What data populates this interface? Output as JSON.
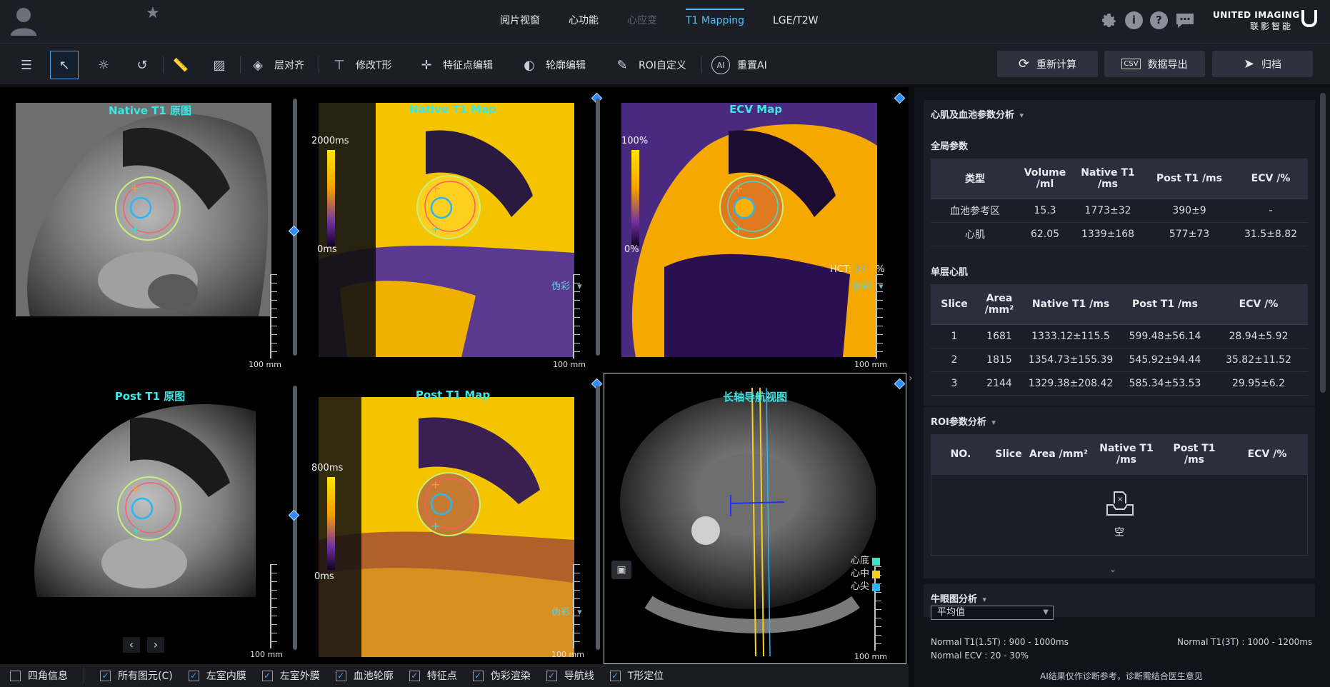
{
  "nav": {
    "tabs": [
      {
        "label": "阅片视窗"
      },
      {
        "label": "心功能"
      },
      {
        "label": "心应变"
      },
      {
        "label": "T1 Mapping"
      },
      {
        "label": "LGE/T2W"
      }
    ],
    "active_tab": "T1 Mapping",
    "disabled_tab": "心应变"
  },
  "brand": {
    "name_en": "UNITED IMAGING",
    "name_cn": "联影智能"
  },
  "toolbar": {
    "tools": [
      {
        "label": "层对齐"
      },
      {
        "label": "修改T形"
      },
      {
        "label": "特征点编辑"
      },
      {
        "label": "轮廓编辑"
      },
      {
        "label": "ROI自定义"
      },
      {
        "label": "重置AI"
      }
    ],
    "actions": {
      "recalc": "重新计算",
      "export": "数据导出",
      "archive": "归档"
    }
  },
  "viewer": {
    "cells": [
      {
        "title": "Native T1 原图",
        "ruler": "100 mm"
      },
      {
        "title": "Native T1 Map",
        "ruler": "100 mm",
        "cbar_max": "2000ms",
        "cbar_min": "0ms",
        "render": "伪彩"
      },
      {
        "title": "ECV Map",
        "ruler": "100 mm",
        "cbar_max": "100%",
        "cbar_min": "0%",
        "render": "伪彩",
        "hct_label": "HCT:",
        "hct_value": "37",
        "hct_unit": "%"
      },
      {
        "title": "Post T1 原图",
        "ruler": "100 mm"
      },
      {
        "title": "Post T1 Map",
        "ruler": "100 mm",
        "cbar_max": "800ms",
        "cbar_min": "0ms",
        "render": "伪彩"
      },
      {
        "title": "长轴导航视图",
        "ruler": "100 mm",
        "legend": [
          "心底",
          "心中",
          "心尖"
        ]
      }
    ],
    "legend_colors": [
      "#3de0c8",
      "#f5d020",
      "#29b6f6"
    ]
  },
  "bottombar": {
    "checks": [
      {
        "label": "四角信息",
        "checked": false
      },
      {
        "label": "所有图元(C)",
        "checked": true
      },
      {
        "label": "左室内膜",
        "checked": true
      },
      {
        "label": "左室外膜",
        "checked": true
      },
      {
        "label": "血池轮廓",
        "checked": true
      },
      {
        "label": "特征点",
        "checked": true
      },
      {
        "label": "伪彩渲染",
        "checked": true
      },
      {
        "label": "导航线",
        "checked": true
      },
      {
        "label": "T形定位",
        "checked": true
      }
    ]
  },
  "panel": {
    "section1": "心肌及血池参数分析",
    "global_title": "全局参数",
    "global_headers": [
      "类型",
      "Volume /ml",
      "Native T1 /ms",
      "Post T1 /ms",
      "ECV /%"
    ],
    "global_rows": [
      [
        "血池参考区",
        "15.3",
        "1773±32",
        "390±9",
        "-"
      ],
      [
        "心肌",
        "62.05",
        "1339±168",
        "577±73",
        "31.5±8.82"
      ]
    ],
    "slice_title": "单层心肌",
    "slice_headers": [
      "Slice",
      "Area /mm²",
      "Native T1 /ms",
      "Post T1 /ms",
      "ECV /%"
    ],
    "slice_rows": [
      [
        "1",
        "1681",
        "1333.12±115.5",
        "599.48±56.14",
        "28.94±5.92"
      ],
      [
        "2",
        "1815",
        "1354.73±155.39",
        "545.92±94.44",
        "35.82±11.52"
      ],
      [
        "3",
        "2144",
        "1329.38±208.42",
        "585.34±53.53",
        "29.95±6.2"
      ]
    ],
    "section2": "ROI参数分析",
    "roi_headers": [
      "NO.",
      "Slice",
      "Area /mm²",
      "Native T1 /ms",
      "Post T1 /ms",
      "ECV /%"
    ],
    "roi_empty": "空",
    "section3": "牛眼图分析",
    "bullseye_select": "平均值",
    "normal_t1_15": "Normal T1(1.5T) : 900 - 1000ms",
    "normal_t1_3": "Normal T1(3T) : 1000 - 1200ms",
    "normal_ecv": "Normal ECV : 20 - 30%",
    "disclaimer": "AI结果仅作诊断参考，诊断需结合医生意见"
  }
}
